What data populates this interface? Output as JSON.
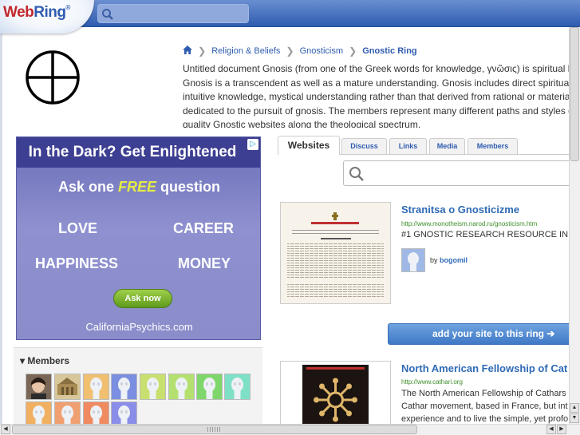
{
  "header": {
    "logo_web": "Web",
    "logo_ring": "Ring",
    "logo_reg": "®",
    "search_placeholder": ""
  },
  "breadcrumb": {
    "items": [
      "Religion & Beliefs",
      "Gnosticism"
    ],
    "current": "Gnostic Ring"
  },
  "description": {
    "lines": [
      "Untitled document Gnosis (from one of the Greek words for knowledge, γνῶσις) is spiritual k",
      "Gnosis is a transcendent as well as a mature understanding. Gnosis includes direct spiritual,",
      "intuitive knowledge, mystical understanding rather than that derived from rational or material",
      "dedicated to the pursuit of gnosis. The members represent many different paths and styles o",
      "quality Gnostic websites along the theological spectrum."
    ]
  },
  "ad": {
    "title": "In the Dark? Get Enlightened",
    "ask_prefix": "Ask one",
    "ask_free": "FREE",
    "ask_suffix": "question",
    "words": [
      "LOVE",
      "CAREER",
      "HAPPINESS",
      "MONEY"
    ],
    "button": "Ask now",
    "footer": "CaliforniaPsychics.com",
    "choice_icon": "▷"
  },
  "members": {
    "label": "Members",
    "toggle": "▾"
  },
  "tabs": [
    "Websites",
    "Discuss",
    "Links",
    "Media",
    "Members"
  ],
  "ring_search": {
    "placeholder": ""
  },
  "sites": [
    {
      "title": "Stranitsa o Gnosticizme",
      "url": "http://www.monotheism.narod.ru/gnosticism.htm",
      "desc": [
        "#1 GNOSTIC RESEARCH RESOURCE IN"
      ],
      "owner_prefix": "by",
      "owner": "bogomil"
    },
    {
      "title": "North American Fellowship of Cat",
      "url": "http://www.cathari.org",
      "desc": [
        "The North American Fellowship of Cathars",
        "Cathar movement, based in France, but int",
        "experience and to live the simple, yet profo"
      ]
    }
  ],
  "add_site": "add your site to this ring ➔",
  "scroll": {
    "left": "◀",
    "right": "▶",
    "up": "▲",
    "down": "▼"
  },
  "colors": {
    "header": "#2f5cb0",
    "link": "#2f6ab5",
    "url": "#3c8f2a",
    "ad_bg": "#8b8dca",
    "free": "#e5ec42"
  }
}
